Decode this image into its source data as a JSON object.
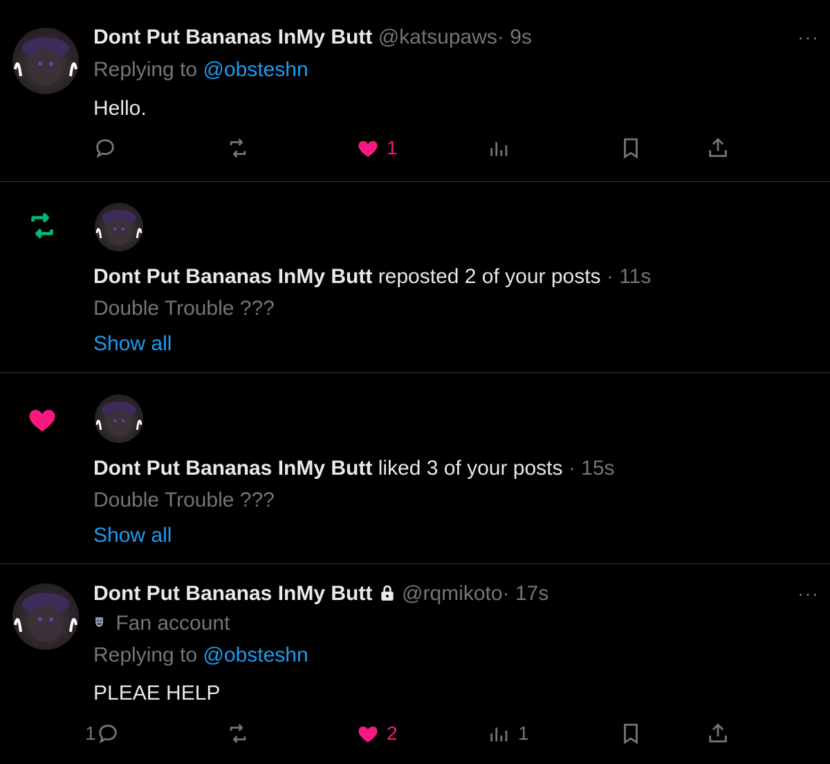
{
  "reply1": {
    "name": "Dont Put Bananas InMy Butt",
    "handle": "@katsupaws",
    "time": "· 9s",
    "replying_prefix": "Replying to",
    "replying_to": "@obsteshn",
    "body": "Hello.",
    "more": "···",
    "likes": "1"
  },
  "repost_notif": {
    "name": "Dont Put Bananas InMy Butt",
    "action": "reposted 2 of your posts",
    "time": "· 11s",
    "post_title": "Double Trouble ???",
    "show_all": "Show all"
  },
  "like_notif": {
    "name": "Dont Put Bananas InMy Butt",
    "action": "liked 3 of your posts",
    "time": "· 15s",
    "post_title": "Double Trouble ???",
    "show_all": "Show all"
  },
  "reply2": {
    "name": "Dont Put Bananas InMy Butt",
    "handle": "@rqmikoto",
    "time": "· 17s",
    "label": "Fan account",
    "replying_prefix": "Replying to",
    "replying_to": "@obsteshn",
    "body": "PLEAE HELP",
    "more": "···",
    "replies": "1",
    "likes": "2",
    "views": "1"
  },
  "colors": {
    "background": "#000000",
    "text": "#e7e9ea",
    "muted": "#71767b",
    "link": "#1d9bf0",
    "like": "#f91880",
    "repost": "#00ba7c"
  }
}
